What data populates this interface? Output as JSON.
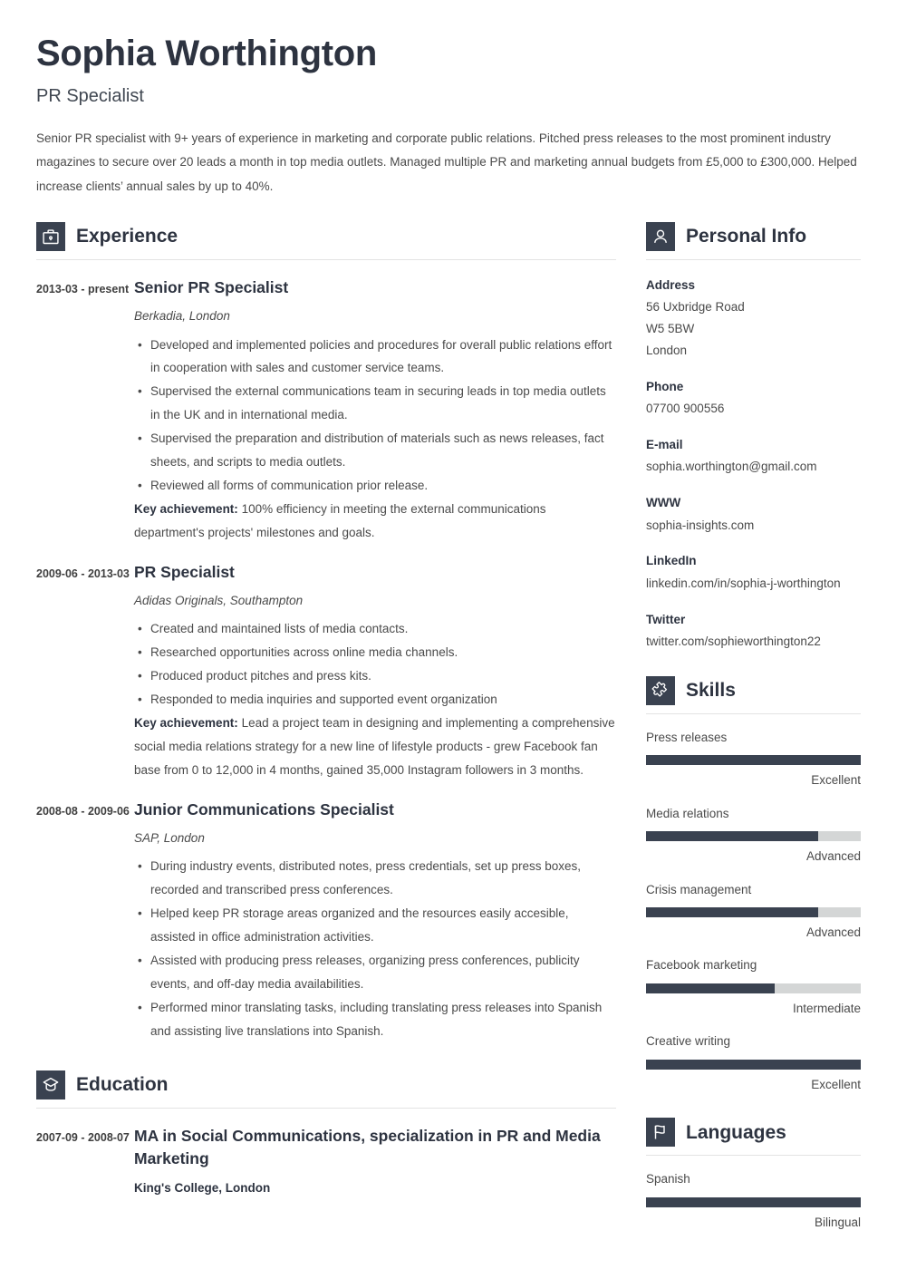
{
  "theme": {
    "dark": "#3a4250",
    "track": "#d4d6d6",
    "text": "#4a4a4a",
    "heading": "#2d3340",
    "divider": "#e3e3e3"
  },
  "header": {
    "name": "Sophia Worthington",
    "job_title": "PR Specialist",
    "summary": "Senior PR specialist with 9+ years of experience in marketing and corporate public relations. Pitched press releases to the most prominent industry magazines to secure over 20 leads a month in top media outlets. Managed multiple PR and marketing annual budgets from £5,000 to £300,000. Helped increase clients’ annual sales by up to 40%."
  },
  "experience": {
    "icon": "briefcase-icon",
    "title": "Experience",
    "entries": [
      {
        "dates": "2013-03 - present",
        "title": "Senior PR Specialist",
        "company": "Berkadia, London",
        "bullets": [
          "Developed and implemented policies and procedures for overall public relations effort in cooperation with sales and customer service teams.",
          "Supervised the external communications team in securing leads in top media outlets in the UK and in international media.",
          "Supervised the preparation and distribution of materials such as news releases, fact sheets, and scripts to media outlets.",
          "Reviewed all forms of communication prior release."
        ],
        "achievement_label": "Key achievement:",
        "achievement_text": "100% efficiency in meeting the external communications department's projects' milestones and goals."
      },
      {
        "dates": "2009-06 - 2013-03",
        "title": "PR Specialist",
        "company": "Adidas Originals, Southampton",
        "bullets": [
          "Created and maintained lists of media contacts.",
          "Researched opportunities across online media channels.",
          "Produced product pitches and press kits.",
          "Responded to media inquiries and supported event organization"
        ],
        "achievement_label": "Key achievement:",
        "achievement_text": "Lead a project team in designing and implementing a comprehensive social media relations strategy for a new line of lifestyle products - grew Facebook fan base from 0 to 12,000 in 4 months, gained 35,000 Instagram followers in 3 months."
      },
      {
        "dates": "2008-08 - 2009-06",
        "title": "Junior Communications Specialist",
        "company": "SAP, London",
        "bullets": [
          "During industry events, distributed notes, press credentials, set up press boxes, recorded and transcribed press conferences.",
          "Helped keep PR storage areas organized and the resources easily accesible, assisted in office administration activities.",
          "Assisted with producing press releases, organizing press conferences, publicity events, and off-day media availabilities.",
          "Performed minor translating tasks, including translating press releases into Spanish and assisting live translations into Spanish."
        ],
        "achievement_label": "",
        "achievement_text": ""
      }
    ]
  },
  "education": {
    "icon": "graduation-cap-icon",
    "title": "Education",
    "entries": [
      {
        "dates": "2007-09 - 2008-07",
        "degree": "MA in Social Communications, specialization in PR and Media Marketing",
        "school": "King's College, London"
      }
    ]
  },
  "personal_info": {
    "icon": "person-icon",
    "title": "Personal Info",
    "groups": [
      {
        "label": "Address",
        "values": [
          "56 Uxbridge Road",
          "W5 5BW",
          "London"
        ]
      },
      {
        "label": "Phone",
        "values": [
          "07700 900556"
        ]
      },
      {
        "label": "E-mail",
        "values": [
          "sophia.worthington@gmail.com"
        ]
      },
      {
        "label": "WWW",
        "values": [
          "sophia-insights.com"
        ]
      },
      {
        "label": "LinkedIn",
        "values": [
          "linkedin.com/in/sophia-j-worthington"
        ]
      },
      {
        "label": "Twitter",
        "values": [
          "twitter.com/sophieworthington22"
        ]
      }
    ]
  },
  "skills": {
    "icon": "puzzle-piece-icon",
    "title": "Skills",
    "items": [
      {
        "name": "Press releases",
        "level": "Excellent",
        "percent": 100
      },
      {
        "name": "Media relations",
        "level": "Advanced",
        "percent": 80
      },
      {
        "name": "Crisis management",
        "level": "Advanced",
        "percent": 80
      },
      {
        "name": "Facebook marketing",
        "level": "Intermediate",
        "percent": 60
      },
      {
        "name": "Creative writing",
        "level": "Excellent",
        "percent": 100
      }
    ]
  },
  "languages": {
    "icon": "flag-icon",
    "title": "Languages",
    "items": [
      {
        "name": "Spanish",
        "level": "Bilingual",
        "percent": 100
      }
    ]
  }
}
